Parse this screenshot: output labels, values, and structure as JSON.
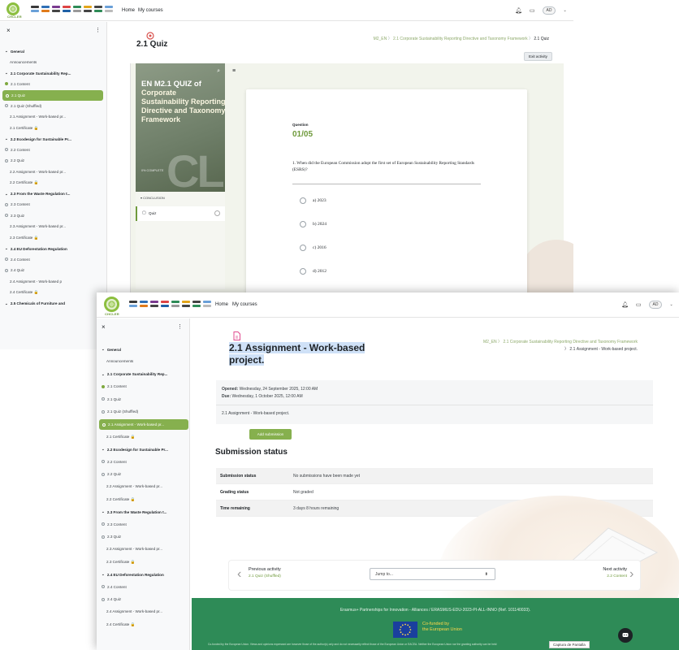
{
  "nav": {
    "logo_text": "CHCLER",
    "links": [
      "Home",
      "My courses"
    ],
    "avatar": "AD"
  },
  "shot1": {
    "close": "×",
    "kebab": "⋮",
    "drawer": [
      {
        "label": "General",
        "kind": "section"
      },
      {
        "label": "Announcements",
        "kind": "plain"
      },
      {
        "label": "2.1 Corporate Sustainability Rep...",
        "kind": "section"
      },
      {
        "label": "2.1 Content",
        "kind": "done"
      },
      {
        "label": "2.1 Quiz",
        "kind": "active"
      },
      {
        "label": "2.1 Quiz (Shuffled)",
        "kind": "todo"
      },
      {
        "label": "2.1 Assignment - Work-based pr...",
        "kind": "plain"
      },
      {
        "label": "2.1 Certificate 🔒",
        "kind": "plain"
      },
      {
        "label": "2.2 Ecodesign for Sustainable Pr...",
        "kind": "section"
      },
      {
        "label": "2.2 Content",
        "kind": "todo"
      },
      {
        "label": "2.2 Quiz",
        "kind": "todo"
      },
      {
        "label": "2.2 Assignment - Work-based pr...",
        "kind": "plain"
      },
      {
        "label": "2.2 Certificate 🔒",
        "kind": "plain"
      },
      {
        "label": "2.3 From the Waste Regulation t...",
        "kind": "section"
      },
      {
        "label": "2.3 Content",
        "kind": "todo"
      },
      {
        "label": "2.3 Quiz",
        "kind": "todo"
      },
      {
        "label": "2.3 Assignment - Work-based pr...",
        "kind": "plain"
      },
      {
        "label": "2.3 Certificate 🔒",
        "kind": "plain"
      },
      {
        "label": "2.4 EU Deforestation Regulation",
        "kind": "section"
      },
      {
        "label": "2.4 Content",
        "kind": "todo"
      },
      {
        "label": "2.4 Quiz",
        "kind": "todo"
      },
      {
        "label": "2.4 Assignment - Work-based p",
        "kind": "plain"
      },
      {
        "label": "2.4 Certificate 🔒",
        "kind": "plain"
      },
      {
        "label": "2.5 Chemicals of Furniture and",
        "kind": "section"
      }
    ],
    "page_title": "2.1 Quiz",
    "breadcrumb": [
      "M2_EN",
      "2.1 Corporate Sustainability Reporting Directive and Taxonomy Framework",
      "2.1 Quiz"
    ],
    "exit_button": "Exit activity",
    "cover": {
      "title_first": "EN M2.1 QUIZ of",
      "title_rest": "Corporate Sustainability Reporting Directive and Taxonomy Framework",
      "big": "CLI",
      "sub": "0% COMPLETE"
    },
    "side": {
      "conclusion": "▾ CONCLUSION",
      "quiz": "Quiz"
    },
    "question": {
      "label": "Question",
      "number": "01/05",
      "text": "1. When did the European Commission adopt the first set of European Sustainability Reporting Standards (ESRS)?",
      "options": [
        "a) 2023",
        "b) 2024",
        "c) 2016",
        "d) 2012"
      ]
    }
  },
  "shot2": {
    "close": "×",
    "kebab": "⋮",
    "drawer": [
      {
        "label": "General",
        "kind": "section"
      },
      {
        "label": "Announcements",
        "kind": "plain"
      },
      {
        "label": "2.1 Corporate Sustainability Rep...",
        "kind": "section"
      },
      {
        "label": "2.1 Content",
        "kind": "done"
      },
      {
        "label": "2.1 Quiz",
        "kind": "todo"
      },
      {
        "label": "2.1 Quiz (Shuffled)",
        "kind": "todo"
      },
      {
        "label": "2.1 Assignment - Work-based pr...",
        "kind": "active"
      },
      {
        "label": "2.1 Certificate 🔒",
        "kind": "plain"
      },
      {
        "label": "2.2 Ecodesign for Sustainable Pr...",
        "kind": "section"
      },
      {
        "label": "2.2 Content",
        "kind": "todo"
      },
      {
        "label": "2.2 Quiz",
        "kind": "todo"
      },
      {
        "label": "2.2 Assignment - Work-based pr...",
        "kind": "plain"
      },
      {
        "label": "2.2 Certificate 🔒",
        "kind": "plain"
      },
      {
        "label": "2.3 From the Waste Regulation t...",
        "kind": "section"
      },
      {
        "label": "2.3 Content",
        "kind": "todo"
      },
      {
        "label": "2.3 Quiz",
        "kind": "todo"
      },
      {
        "label": "2.3 Assignment - Work-based pr...",
        "kind": "plain"
      },
      {
        "label": "2.3 Certificate 🔒",
        "kind": "plain"
      },
      {
        "label": "2.4 EU Deforestation Regulation",
        "kind": "section"
      },
      {
        "label": "2.4 Content",
        "kind": "todo"
      },
      {
        "label": "2.4 Quiz",
        "kind": "todo"
      },
      {
        "label": "2.4 Assignment - Work-based pr...",
        "kind": "plain"
      },
      {
        "label": "2.4 Certificate 🔒",
        "kind": "plain"
      }
    ],
    "title_line1": "2.1 Assignment - Work-based",
    "title_line2": "project.",
    "breadcrumb_line1": "M2_EN  〉 2.1 Corporate Sustainability Reporting Directive and Taxonomy Framework",
    "breadcrumb_line2": "〉 2.1 Assignment - Work-based project.",
    "opened_label": "Opened:",
    "opened_value": " Wednesday, 24 September 2025, 12:00 AM",
    "due_label": "Due:",
    "due_value": " Wednesday, 1 October 2025, 12:00 AM",
    "description": "2.1 Assignment - Work-based project.",
    "add_submission": "Add submission",
    "submission_heading": "Submission status",
    "status_rows": [
      {
        "k": "Submission status",
        "v": "No submissions have been made yet"
      },
      {
        "k": "Grading status",
        "v": "Not graded"
      },
      {
        "k": "Time remaining",
        "v": "3 days 8 hours remaining"
      }
    ],
    "prev_label": "Previous activity",
    "prev_link": "2.1 Quiz (Shuffled)",
    "jump": "Jump to...",
    "next_label": "Next activity",
    "next_link": "2.2 Content",
    "footer_text": "Erasmus+ Partnerships for Innovation - Alliances / ERASMUS-EDU-2023-PI-ALL-INNO (Ref. 101140033).",
    "eu_line1": "Co-funded by",
    "eu_line2": "the European Union",
    "disclaimer": "Co-funded by the European Union. Views and opinions expressed are however those of the author(s) only and do not necessarily reflect those of the European Union or EACEA. Neither the European Union nor the granting authority can be held",
    "captura": "Captura de Pantalla"
  },
  "colors": {
    "accent": "#86b04e",
    "footer": "#2e8b57",
    "breadcrumb": "#8da96a"
  }
}
